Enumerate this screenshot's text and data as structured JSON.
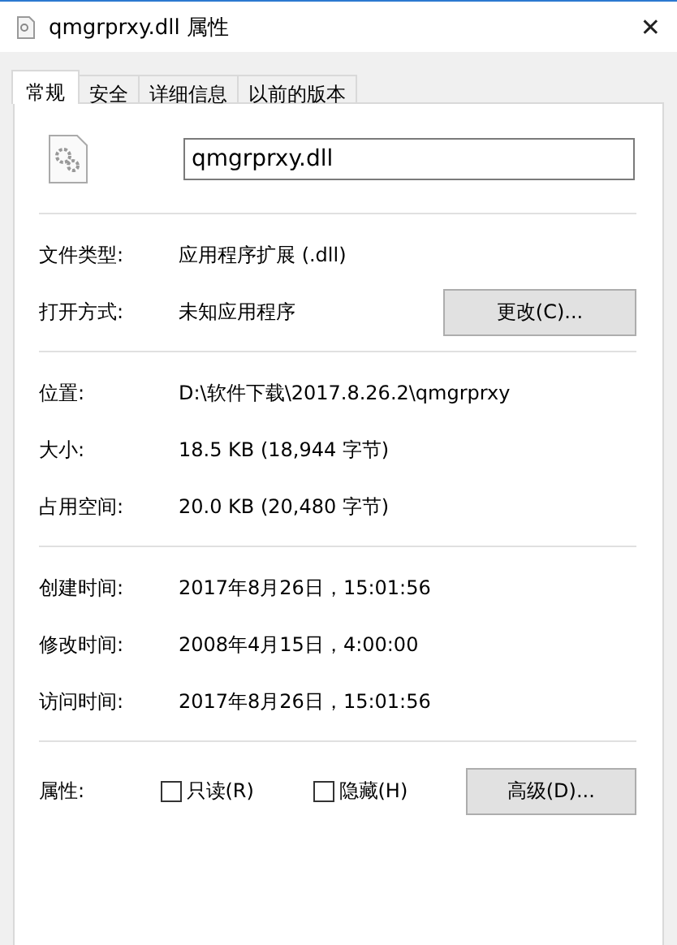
{
  "window": {
    "title": "qmgrprxy.dll 属性",
    "close": "✕"
  },
  "tabs": [
    {
      "label": "常规",
      "selected": true
    },
    {
      "label": "安全",
      "selected": false
    },
    {
      "label": "详细信息",
      "selected": false
    },
    {
      "label": "以前的版本",
      "selected": false
    }
  ],
  "file_name": "qmgrprxy.dll",
  "sections": [
    {
      "rows": [
        {
          "label": "文件类型:",
          "value": "应用程序扩展 (.dll)"
        },
        {
          "label": "打开方式:",
          "value": "未知应用程序",
          "button": "更改(C)..."
        }
      ]
    },
    {
      "rows": [
        {
          "label": "位置:",
          "value": "D:\\软件下载\\2017.8.26.2\\qmgrprxy"
        },
        {
          "label": "大小:",
          "value": "18.5 KB (18,944 字节)"
        },
        {
          "label": "占用空间:",
          "value": "20.0 KB (20,480 字节)"
        }
      ]
    },
    {
      "rows": [
        {
          "label": "创建时间:",
          "value": "2017年8月26日，15:01:56"
        },
        {
          "label": "修改时间:",
          "value": "2008年4月15日，4:00:00"
        },
        {
          "label": "访问时间:",
          "value": "2017年8月26日，15:01:56"
        }
      ]
    }
  ],
  "attributes": {
    "label": "属性:",
    "checkboxes": [
      {
        "label": "只读(R)",
        "checked": false
      },
      {
        "label": "隐藏(H)",
        "checked": false
      }
    ],
    "button": "高级(D)..."
  }
}
